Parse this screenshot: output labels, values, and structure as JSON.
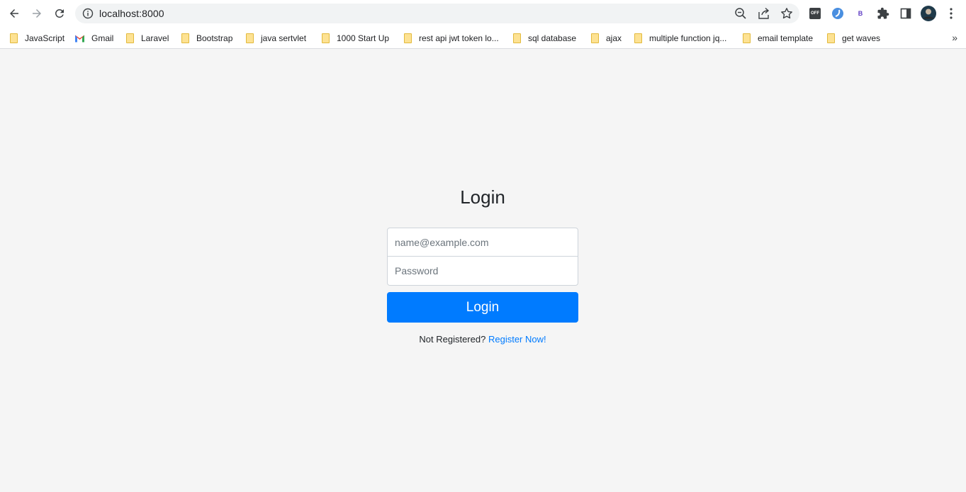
{
  "browser": {
    "url": "localhost:8000",
    "bookmarks": [
      {
        "label": "JavaScript",
        "icon": "folder-icon"
      },
      {
        "label": "Gmail",
        "icon": "gmail-icon"
      },
      {
        "label": "Laravel",
        "icon": "folder-icon"
      },
      {
        "label": "Bootstrap",
        "icon": "folder-icon"
      },
      {
        "label": "java sertvlet",
        "icon": "folder-icon"
      },
      {
        "label": "1000 Start Up",
        "icon": "folder-icon"
      },
      {
        "label": "rest api jwt token lo...",
        "icon": "folder-icon"
      },
      {
        "label": "sql database",
        "icon": "folder-icon"
      },
      {
        "label": "ajax",
        "icon": "folder-icon"
      },
      {
        "label": "multiple function jq...",
        "icon": "folder-icon"
      },
      {
        "label": "email template",
        "icon": "folder-icon"
      },
      {
        "label": "get waves",
        "icon": "folder-icon"
      }
    ],
    "more_bookmarks": "»",
    "extension_off_label": "OFF",
    "extension_b_label": "B"
  },
  "login": {
    "title": "Login",
    "email_placeholder": "name@example.com",
    "email_value": "",
    "password_placeholder": "Password",
    "password_value": "",
    "button_label": "Login",
    "register_prompt": "Not Registered?",
    "register_link": "Register Now!"
  },
  "colors": {
    "primary": "#007bff",
    "background": "#f5f5f5",
    "text": "#212529"
  }
}
